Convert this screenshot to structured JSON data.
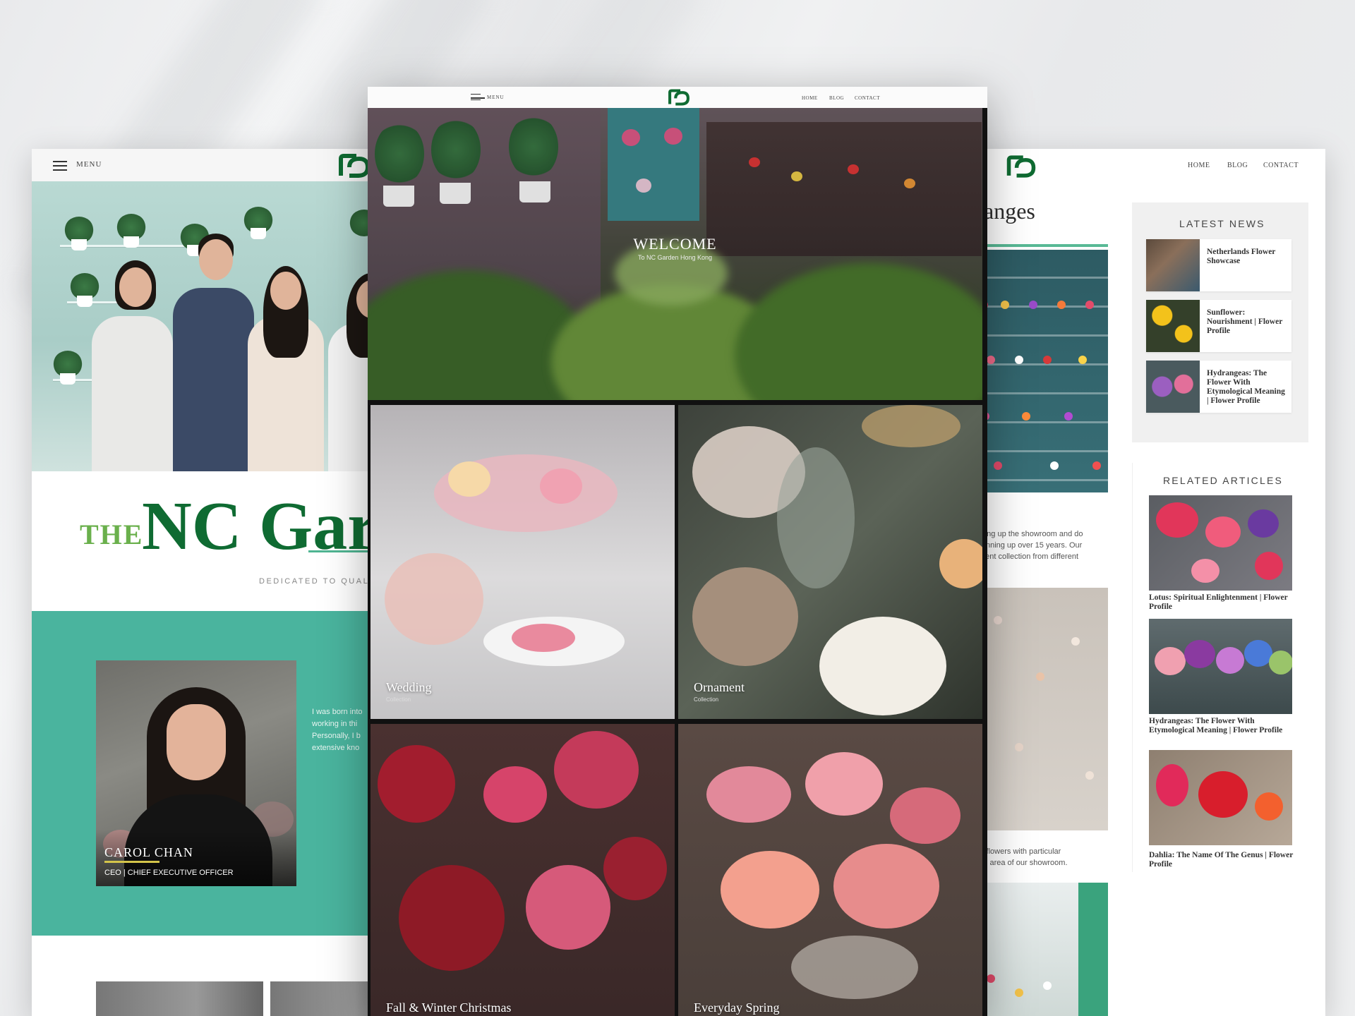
{
  "background": {
    "color": "#ebecee"
  },
  "left_page": {
    "menu_label": "MENU",
    "title_the": "THE",
    "title_main": "NC Garden",
    "tagline": "DEDICATED TO QUALITY",
    "ceo": {
      "name": "CAROL CHAN",
      "role": "CEO | CHIEF EXECUTIVE OFFICER"
    },
    "bio_lines": [
      "I was born into",
      "working in thi",
      "Personally, I b",
      "extensive kno"
    ],
    "colors": {
      "brand_green": "#0f6b32",
      "light_green": "#6ab04c",
      "teal": "#4ab49e"
    }
  },
  "center_page": {
    "menu_label": "MENU",
    "nav": [
      "HOME",
      "BLOG",
      "CONTACT"
    ],
    "hero_title": "WELCOME",
    "hero_subtitle": "To NC Garden Hong Kong",
    "collections": [
      {
        "title": "Wedding",
        "subtitle": "Collection"
      },
      {
        "title": "Ornament",
        "subtitle": "Collection"
      },
      {
        "title": "Fall & Winter Christmas",
        "subtitle": ""
      },
      {
        "title": "Everyday Spring",
        "subtitle": ""
      }
    ]
  },
  "right_page": {
    "nav": [
      "HOME",
      "BLOG",
      "CONTACT"
    ],
    "article_heading": "hanges",
    "paragraph1": [
      "setting up the showroom and do",
      "n running up over 15 years. Our",
      "ifferent collection from different"
    ],
    "paragraph2": [
      "cial flowers with particular",
      "t the area of our showroom."
    ],
    "latest_news_heading": "LATEST NEWS",
    "latest_news": [
      {
        "title": "Netherlands Flower Showcase"
      },
      {
        "title": "Sunflower: Nourishment | Flower Profile"
      },
      {
        "title": "Hydrangeas: The Flower With Etymological Meaning | Flower Profile"
      }
    ],
    "related_heading": "RELATED ARTICLES",
    "related": [
      {
        "title": "Lotus: Spiritual Enlightenment | Flower Profile"
      },
      {
        "title": "Hydrangeas: The Flower With Etymological Meaning | Flower Profile"
      },
      {
        "title": "Dahlia: The Name Of The Genus | Flower Profile"
      }
    ]
  }
}
